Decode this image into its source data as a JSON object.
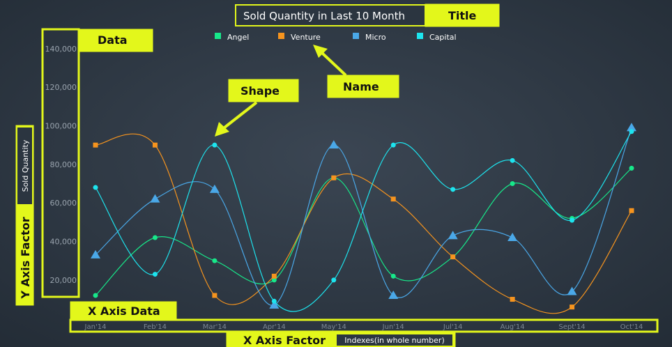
{
  "chart_data": {
    "type": "line",
    "title": "Sold Quantity in Last 10 Month",
    "ylabel": "Sold Quantity",
    "xlabel": "Indexes(in whole number)",
    "categories": [
      "Jan'14",
      "Feb'14",
      "Mar'14",
      "Apr'14",
      "May'14",
      "Jun'14",
      "Jul'14",
      "Aug'14",
      "Sept'14",
      "Oct'14"
    ],
    "yticks": [
      "20,000",
      "40,000",
      "60,000",
      "80,000",
      "100,000",
      "120,000",
      "140,000"
    ],
    "ylim": [
      12000,
      145000
    ],
    "legend_position": "top-center",
    "grid": false,
    "series": [
      {
        "name": "Angel",
        "color": "#17e88a",
        "marker": "circle",
        "values": [
          12000,
          42000,
          30000,
          20000,
          73000,
          22000,
          32000,
          70000,
          52000,
          78000
        ]
      },
      {
        "name": "Venture",
        "color": "#f6941e",
        "marker": "square",
        "values": [
          90000,
          90000,
          12000,
          22000,
          73000,
          62000,
          32000,
          10000,
          6000,
          56000
        ]
      },
      {
        "name": "Micro",
        "color": "#4aa8e8",
        "marker": "triangle",
        "values": [
          33000,
          62000,
          67000,
          7000,
          90000,
          12000,
          43000,
          42000,
          14000,
          99000
        ]
      },
      {
        "name": "Capital",
        "color": "#1de4ee",
        "marker": "circle",
        "values": [
          68000,
          23000,
          90000,
          9000,
          20000,
          90000,
          67000,
          82000,
          51000,
          97000
        ]
      }
    ]
  },
  "annotations": {
    "title": "Title",
    "data": "Data",
    "shape": "Shape",
    "name": "Name",
    "y_axis_factor": "Y Axis Factor",
    "x_axis_data": "X Axis Data",
    "x_axis_factor": "X Axis Factor"
  }
}
